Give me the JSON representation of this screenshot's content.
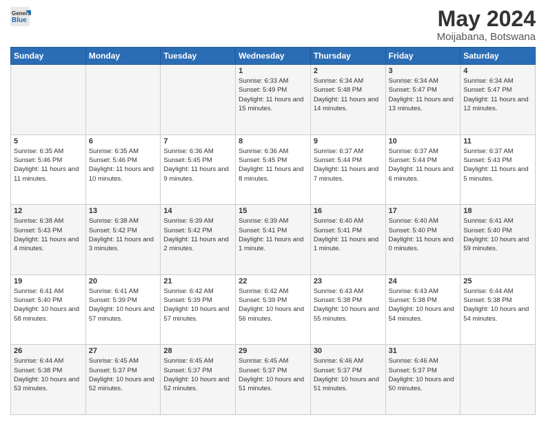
{
  "logo": {
    "line1": "General",
    "line2": "Blue"
  },
  "title": "May 2024",
  "subtitle": "Moijabana, Botswana",
  "days": [
    "Sunday",
    "Monday",
    "Tuesday",
    "Wednesday",
    "Thursday",
    "Friday",
    "Saturday"
  ],
  "weeks": [
    [
      {
        "num": "",
        "sunrise": "",
        "sunset": "",
        "daylight": ""
      },
      {
        "num": "",
        "sunrise": "",
        "sunset": "",
        "daylight": ""
      },
      {
        "num": "",
        "sunrise": "",
        "sunset": "",
        "daylight": ""
      },
      {
        "num": "1",
        "sunrise": "Sunrise: 6:33 AM",
        "sunset": "Sunset: 5:49 PM",
        "daylight": "Daylight: 11 hours and 15 minutes."
      },
      {
        "num": "2",
        "sunrise": "Sunrise: 6:34 AM",
        "sunset": "Sunset: 5:48 PM",
        "daylight": "Daylight: 11 hours and 14 minutes."
      },
      {
        "num": "3",
        "sunrise": "Sunrise: 6:34 AM",
        "sunset": "Sunset: 5:47 PM",
        "daylight": "Daylight: 11 hours and 13 minutes."
      },
      {
        "num": "4",
        "sunrise": "Sunrise: 6:34 AM",
        "sunset": "Sunset: 5:47 PM",
        "daylight": "Daylight: 11 hours and 12 minutes."
      }
    ],
    [
      {
        "num": "5",
        "sunrise": "Sunrise: 6:35 AM",
        "sunset": "Sunset: 5:46 PM",
        "daylight": "Daylight: 11 hours and 11 minutes."
      },
      {
        "num": "6",
        "sunrise": "Sunrise: 6:35 AM",
        "sunset": "Sunset: 5:46 PM",
        "daylight": "Daylight: 11 hours and 10 minutes."
      },
      {
        "num": "7",
        "sunrise": "Sunrise: 6:36 AM",
        "sunset": "Sunset: 5:45 PM",
        "daylight": "Daylight: 11 hours and 9 minutes."
      },
      {
        "num": "8",
        "sunrise": "Sunrise: 6:36 AM",
        "sunset": "Sunset: 5:45 PM",
        "daylight": "Daylight: 11 hours and 8 minutes."
      },
      {
        "num": "9",
        "sunrise": "Sunrise: 6:37 AM",
        "sunset": "Sunset: 5:44 PM",
        "daylight": "Daylight: 11 hours and 7 minutes."
      },
      {
        "num": "10",
        "sunrise": "Sunrise: 6:37 AM",
        "sunset": "Sunset: 5:44 PM",
        "daylight": "Daylight: 11 hours and 6 minutes."
      },
      {
        "num": "11",
        "sunrise": "Sunrise: 6:37 AM",
        "sunset": "Sunset: 5:43 PM",
        "daylight": "Daylight: 11 hours and 5 minutes."
      }
    ],
    [
      {
        "num": "12",
        "sunrise": "Sunrise: 6:38 AM",
        "sunset": "Sunset: 5:43 PM",
        "daylight": "Daylight: 11 hours and 4 minutes."
      },
      {
        "num": "13",
        "sunrise": "Sunrise: 6:38 AM",
        "sunset": "Sunset: 5:42 PM",
        "daylight": "Daylight: 11 hours and 3 minutes."
      },
      {
        "num": "14",
        "sunrise": "Sunrise: 6:39 AM",
        "sunset": "Sunset: 5:42 PM",
        "daylight": "Daylight: 11 hours and 2 minutes."
      },
      {
        "num": "15",
        "sunrise": "Sunrise: 6:39 AM",
        "sunset": "Sunset: 5:41 PM",
        "daylight": "Daylight: 11 hours and 1 minute."
      },
      {
        "num": "16",
        "sunrise": "Sunrise: 6:40 AM",
        "sunset": "Sunset: 5:41 PM",
        "daylight": "Daylight: 11 hours and 1 minute."
      },
      {
        "num": "17",
        "sunrise": "Sunrise: 6:40 AM",
        "sunset": "Sunset: 5:40 PM",
        "daylight": "Daylight: 11 hours and 0 minutes."
      },
      {
        "num": "18",
        "sunrise": "Sunrise: 6:41 AM",
        "sunset": "Sunset: 5:40 PM",
        "daylight": "Daylight: 10 hours and 59 minutes."
      }
    ],
    [
      {
        "num": "19",
        "sunrise": "Sunrise: 6:41 AM",
        "sunset": "Sunset: 5:40 PM",
        "daylight": "Daylight: 10 hours and 58 minutes."
      },
      {
        "num": "20",
        "sunrise": "Sunrise: 6:41 AM",
        "sunset": "Sunset: 5:39 PM",
        "daylight": "Daylight: 10 hours and 57 minutes."
      },
      {
        "num": "21",
        "sunrise": "Sunrise: 6:42 AM",
        "sunset": "Sunset: 5:39 PM",
        "daylight": "Daylight: 10 hours and 57 minutes."
      },
      {
        "num": "22",
        "sunrise": "Sunrise: 6:42 AM",
        "sunset": "Sunset: 5:39 PM",
        "daylight": "Daylight: 10 hours and 56 minutes."
      },
      {
        "num": "23",
        "sunrise": "Sunrise: 6:43 AM",
        "sunset": "Sunset: 5:38 PM",
        "daylight": "Daylight: 10 hours and 55 minutes."
      },
      {
        "num": "24",
        "sunrise": "Sunrise: 6:43 AM",
        "sunset": "Sunset: 5:38 PM",
        "daylight": "Daylight: 10 hours and 54 minutes."
      },
      {
        "num": "25",
        "sunrise": "Sunrise: 6:44 AM",
        "sunset": "Sunset: 5:38 PM",
        "daylight": "Daylight: 10 hours and 54 minutes."
      }
    ],
    [
      {
        "num": "26",
        "sunrise": "Sunrise: 6:44 AM",
        "sunset": "Sunset: 5:38 PM",
        "daylight": "Daylight: 10 hours and 53 minutes."
      },
      {
        "num": "27",
        "sunrise": "Sunrise: 6:45 AM",
        "sunset": "Sunset: 5:37 PM",
        "daylight": "Daylight: 10 hours and 52 minutes."
      },
      {
        "num": "28",
        "sunrise": "Sunrise: 6:45 AM",
        "sunset": "Sunset: 5:37 PM",
        "daylight": "Daylight: 10 hours and 52 minutes."
      },
      {
        "num": "29",
        "sunrise": "Sunrise: 6:45 AM",
        "sunset": "Sunset: 5:37 PM",
        "daylight": "Daylight: 10 hours and 51 minutes."
      },
      {
        "num": "30",
        "sunrise": "Sunrise: 6:46 AM",
        "sunset": "Sunset: 5:37 PM",
        "daylight": "Daylight: 10 hours and 51 minutes."
      },
      {
        "num": "31",
        "sunrise": "Sunrise: 6:46 AM",
        "sunset": "Sunset: 5:37 PM",
        "daylight": "Daylight: 10 hours and 50 minutes."
      },
      {
        "num": "",
        "sunrise": "",
        "sunset": "",
        "daylight": ""
      }
    ]
  ]
}
